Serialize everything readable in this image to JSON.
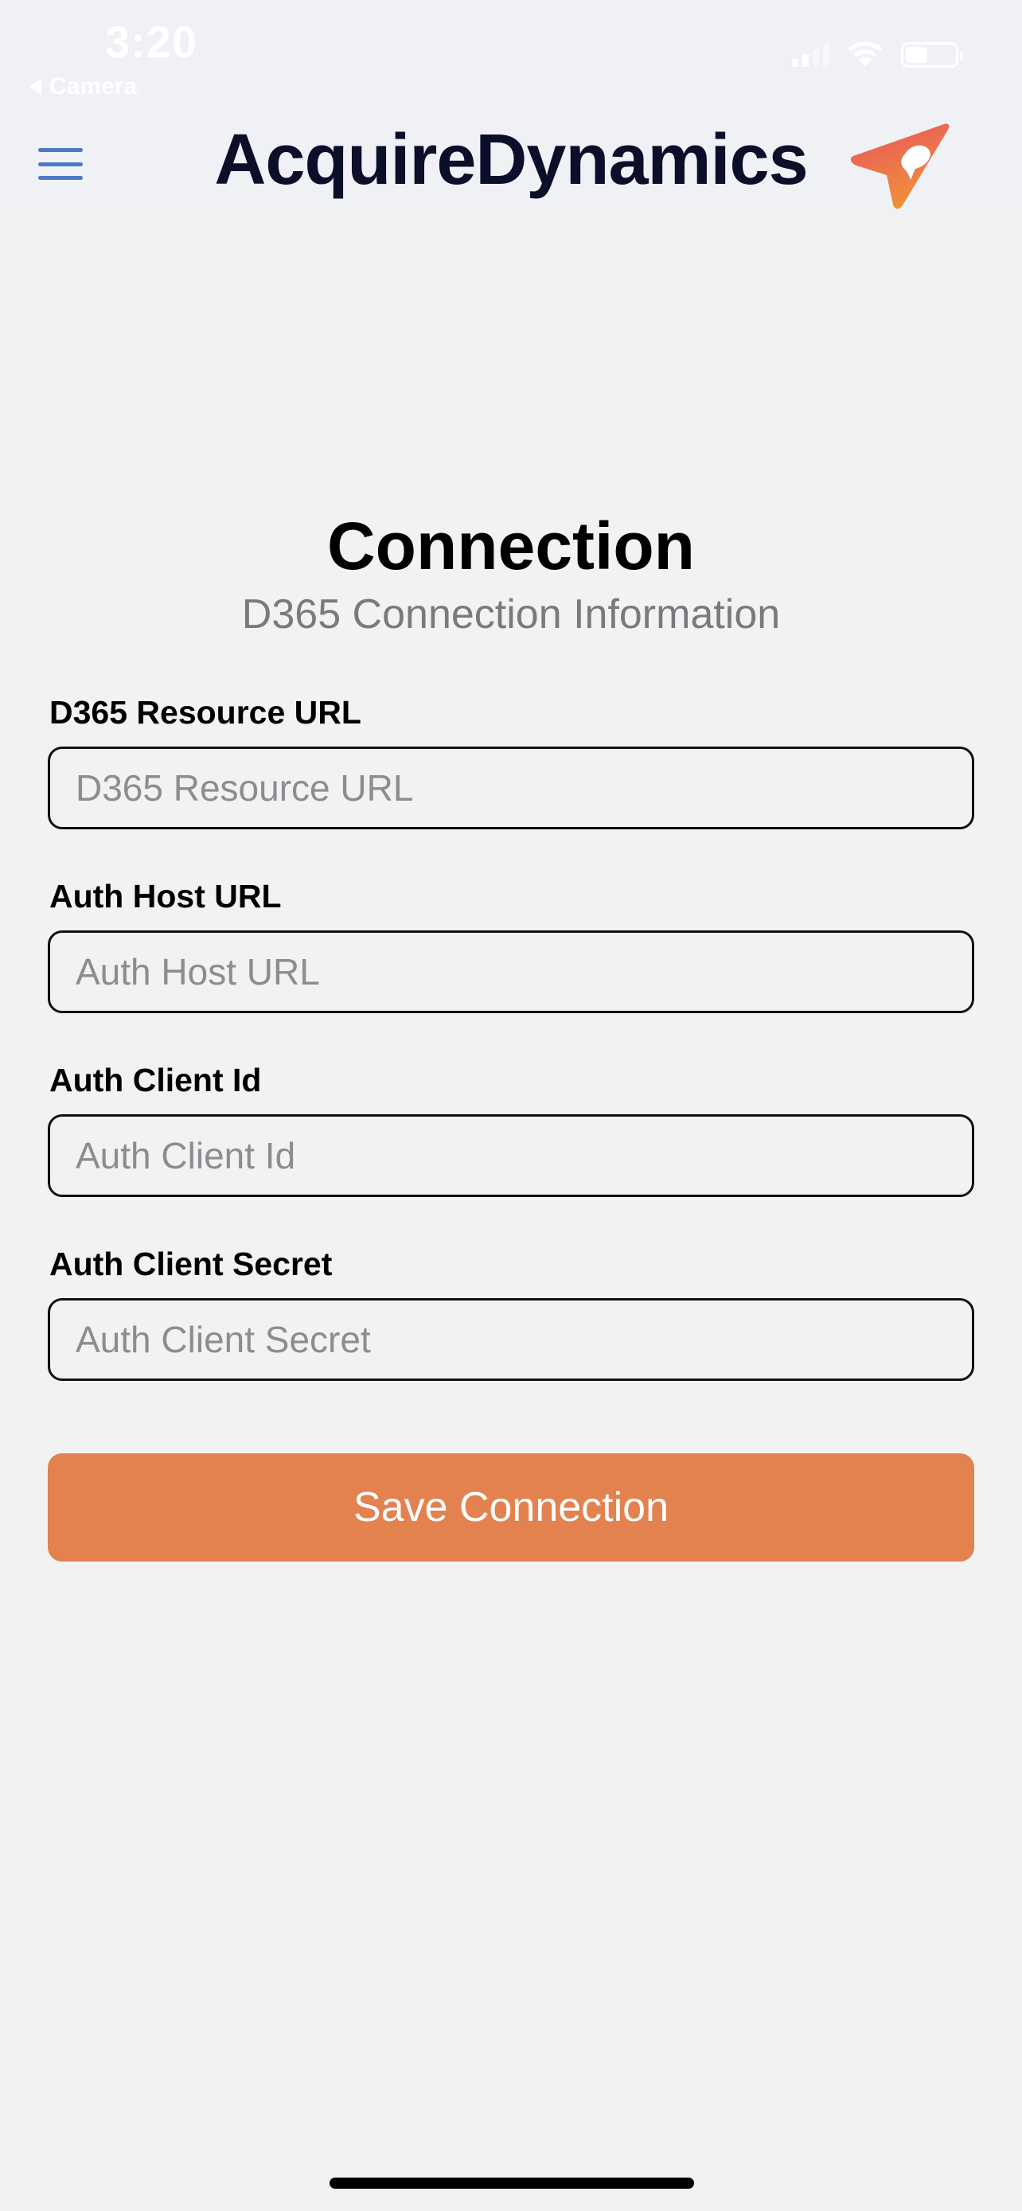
{
  "status_bar": {
    "time": "3:20",
    "back_label": "Camera",
    "signal_icon": "cellular-signal-icon",
    "wifi_icon": "wifi-icon",
    "battery_icon": "battery-icon",
    "battery_level": 0.45
  },
  "nav": {
    "menu_icon": "hamburger-menu-icon",
    "title": "AcquireDynamics",
    "logo_icon": "paper-plane-pin-logo-icon",
    "accent_color": "#4d79c7"
  },
  "page": {
    "title": "Connection",
    "subtitle": "D365 Connection Information"
  },
  "form": {
    "fields": [
      {
        "label": "D365 Resource URL",
        "placeholder": "D365 Resource URL",
        "value": ""
      },
      {
        "label": "Auth Host URL",
        "placeholder": "Auth Host URL",
        "value": ""
      },
      {
        "label": "Auth Client Id",
        "placeholder": "Auth Client Id",
        "value": ""
      },
      {
        "label": "Auth Client Secret",
        "placeholder": "Auth Client Secret",
        "value": ""
      }
    ],
    "save_label": "Save Connection",
    "save_color": "#e3814f"
  }
}
